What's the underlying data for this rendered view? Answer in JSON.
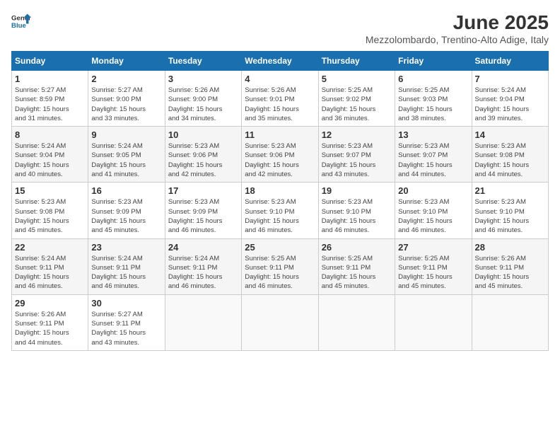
{
  "logo": {
    "line1": "General",
    "line2": "Blue"
  },
  "calendar": {
    "title": "June 2025",
    "subtitle": "Mezzolombardo, Trentino-Alto Adige, Italy",
    "headers": [
      "Sunday",
      "Monday",
      "Tuesday",
      "Wednesday",
      "Thursday",
      "Friday",
      "Saturday"
    ],
    "weeks": [
      [
        {
          "day": "",
          "info": ""
        },
        {
          "day": "2",
          "info": "Sunrise: 5:27 AM\nSunset: 9:00 PM\nDaylight: 15 hours\nand 33 minutes."
        },
        {
          "day": "3",
          "info": "Sunrise: 5:26 AM\nSunset: 9:00 PM\nDaylight: 15 hours\nand 34 minutes."
        },
        {
          "day": "4",
          "info": "Sunrise: 5:26 AM\nSunset: 9:01 PM\nDaylight: 15 hours\nand 35 minutes."
        },
        {
          "day": "5",
          "info": "Sunrise: 5:25 AM\nSunset: 9:02 PM\nDaylight: 15 hours\nand 36 minutes."
        },
        {
          "day": "6",
          "info": "Sunrise: 5:25 AM\nSunset: 9:03 PM\nDaylight: 15 hours\nand 38 minutes."
        },
        {
          "day": "7",
          "info": "Sunrise: 5:24 AM\nSunset: 9:04 PM\nDaylight: 15 hours\nand 39 minutes."
        }
      ],
      [
        {
          "day": "8",
          "info": "Sunrise: 5:24 AM\nSunset: 9:04 PM\nDaylight: 15 hours\nand 40 minutes."
        },
        {
          "day": "9",
          "info": "Sunrise: 5:24 AM\nSunset: 9:05 PM\nDaylight: 15 hours\nand 41 minutes."
        },
        {
          "day": "10",
          "info": "Sunrise: 5:23 AM\nSunset: 9:06 PM\nDaylight: 15 hours\nand 42 minutes."
        },
        {
          "day": "11",
          "info": "Sunrise: 5:23 AM\nSunset: 9:06 PM\nDaylight: 15 hours\nand 42 minutes."
        },
        {
          "day": "12",
          "info": "Sunrise: 5:23 AM\nSunset: 9:07 PM\nDaylight: 15 hours\nand 43 minutes."
        },
        {
          "day": "13",
          "info": "Sunrise: 5:23 AM\nSunset: 9:07 PM\nDaylight: 15 hours\nand 44 minutes."
        },
        {
          "day": "14",
          "info": "Sunrise: 5:23 AM\nSunset: 9:08 PM\nDaylight: 15 hours\nand 44 minutes."
        }
      ],
      [
        {
          "day": "15",
          "info": "Sunrise: 5:23 AM\nSunset: 9:08 PM\nDaylight: 15 hours\nand 45 minutes."
        },
        {
          "day": "16",
          "info": "Sunrise: 5:23 AM\nSunset: 9:09 PM\nDaylight: 15 hours\nand 45 minutes."
        },
        {
          "day": "17",
          "info": "Sunrise: 5:23 AM\nSunset: 9:09 PM\nDaylight: 15 hours\nand 46 minutes."
        },
        {
          "day": "18",
          "info": "Sunrise: 5:23 AM\nSunset: 9:10 PM\nDaylight: 15 hours\nand 46 minutes."
        },
        {
          "day": "19",
          "info": "Sunrise: 5:23 AM\nSunset: 9:10 PM\nDaylight: 15 hours\nand 46 minutes."
        },
        {
          "day": "20",
          "info": "Sunrise: 5:23 AM\nSunset: 9:10 PM\nDaylight: 15 hours\nand 46 minutes."
        },
        {
          "day": "21",
          "info": "Sunrise: 5:23 AM\nSunset: 9:10 PM\nDaylight: 15 hours\nand 46 minutes."
        }
      ],
      [
        {
          "day": "22",
          "info": "Sunrise: 5:24 AM\nSunset: 9:11 PM\nDaylight: 15 hours\nand 46 minutes."
        },
        {
          "day": "23",
          "info": "Sunrise: 5:24 AM\nSunset: 9:11 PM\nDaylight: 15 hours\nand 46 minutes."
        },
        {
          "day": "24",
          "info": "Sunrise: 5:24 AM\nSunset: 9:11 PM\nDaylight: 15 hours\nand 46 minutes."
        },
        {
          "day": "25",
          "info": "Sunrise: 5:25 AM\nSunset: 9:11 PM\nDaylight: 15 hours\nand 46 minutes."
        },
        {
          "day": "26",
          "info": "Sunrise: 5:25 AM\nSunset: 9:11 PM\nDaylight: 15 hours\nand 45 minutes."
        },
        {
          "day": "27",
          "info": "Sunrise: 5:25 AM\nSunset: 9:11 PM\nDaylight: 15 hours\nand 45 minutes."
        },
        {
          "day": "28",
          "info": "Sunrise: 5:26 AM\nSunset: 9:11 PM\nDaylight: 15 hours\nand 45 minutes."
        }
      ],
      [
        {
          "day": "29",
          "info": "Sunrise: 5:26 AM\nSunset: 9:11 PM\nDaylight: 15 hours\nand 44 minutes."
        },
        {
          "day": "30",
          "info": "Sunrise: 5:27 AM\nSunset: 9:11 PM\nDaylight: 15 hours\nand 43 minutes."
        },
        {
          "day": "",
          "info": ""
        },
        {
          "day": "",
          "info": ""
        },
        {
          "day": "",
          "info": ""
        },
        {
          "day": "",
          "info": ""
        },
        {
          "day": "",
          "info": ""
        }
      ]
    ],
    "week1_day1": {
      "day": "1",
      "info": "Sunrise: 5:27 AM\nSunset: 8:59 PM\nDaylight: 15 hours\nand 31 minutes."
    }
  }
}
